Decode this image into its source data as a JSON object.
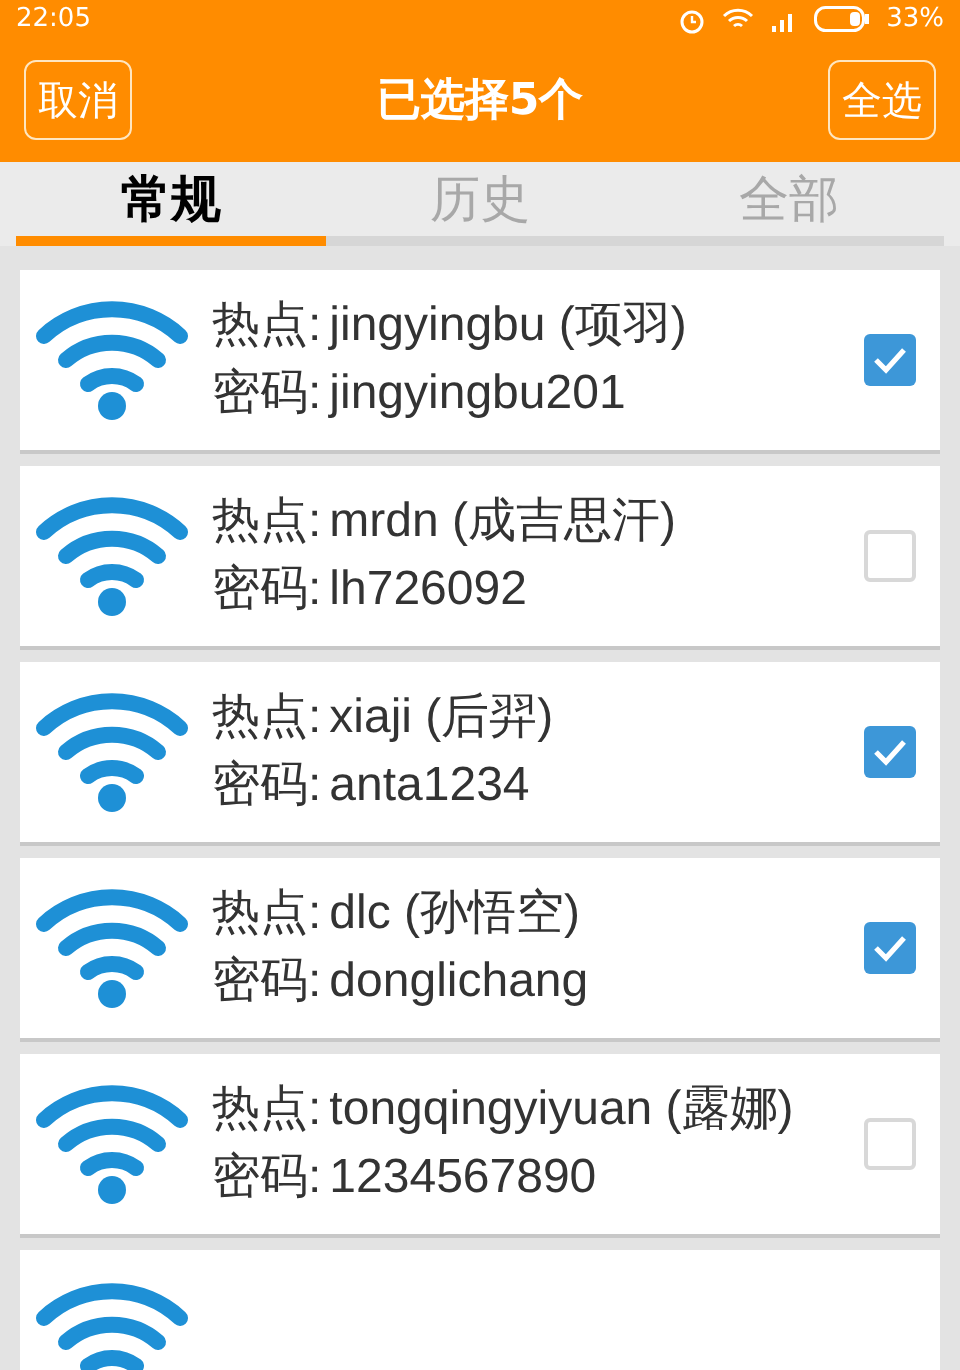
{
  "status_bar": {
    "time": "22:05",
    "battery": "33%"
  },
  "header": {
    "cancel": "取消",
    "title": "已选择5个",
    "select_all": "全选"
  },
  "tabs": [
    {
      "label": "常规",
      "selected": true
    },
    {
      "label": "历史",
      "selected": false
    },
    {
      "label": "全部",
      "selected": false
    }
  ],
  "hotspots": [
    {
      "ssid_label": "热点:",
      "ssid": "jingyingbu (项羽)",
      "password_label": "密码:",
      "password": "jingyingbu201",
      "checked": true
    },
    {
      "ssid_label": "热点:",
      "ssid": "mrdn (成吉思汗)",
      "password_label": "密码:",
      "password": "lh726092",
      "checked": false
    },
    {
      "ssid_label": "热点:",
      "ssid": "xiaji (后羿)",
      "password_label": "密码:",
      "password": "anta1234",
      "checked": true
    },
    {
      "ssid_label": "热点:",
      "ssid": "dlc (孙悟空)",
      "password_label": "密码:",
      "password": "donglichang",
      "checked": true
    },
    {
      "ssid_label": "热点:",
      "ssid": "tongqingyiyuan (露娜)",
      "password_label": "密码:",
      "password": "1234567890",
      "checked": false
    }
  ]
}
